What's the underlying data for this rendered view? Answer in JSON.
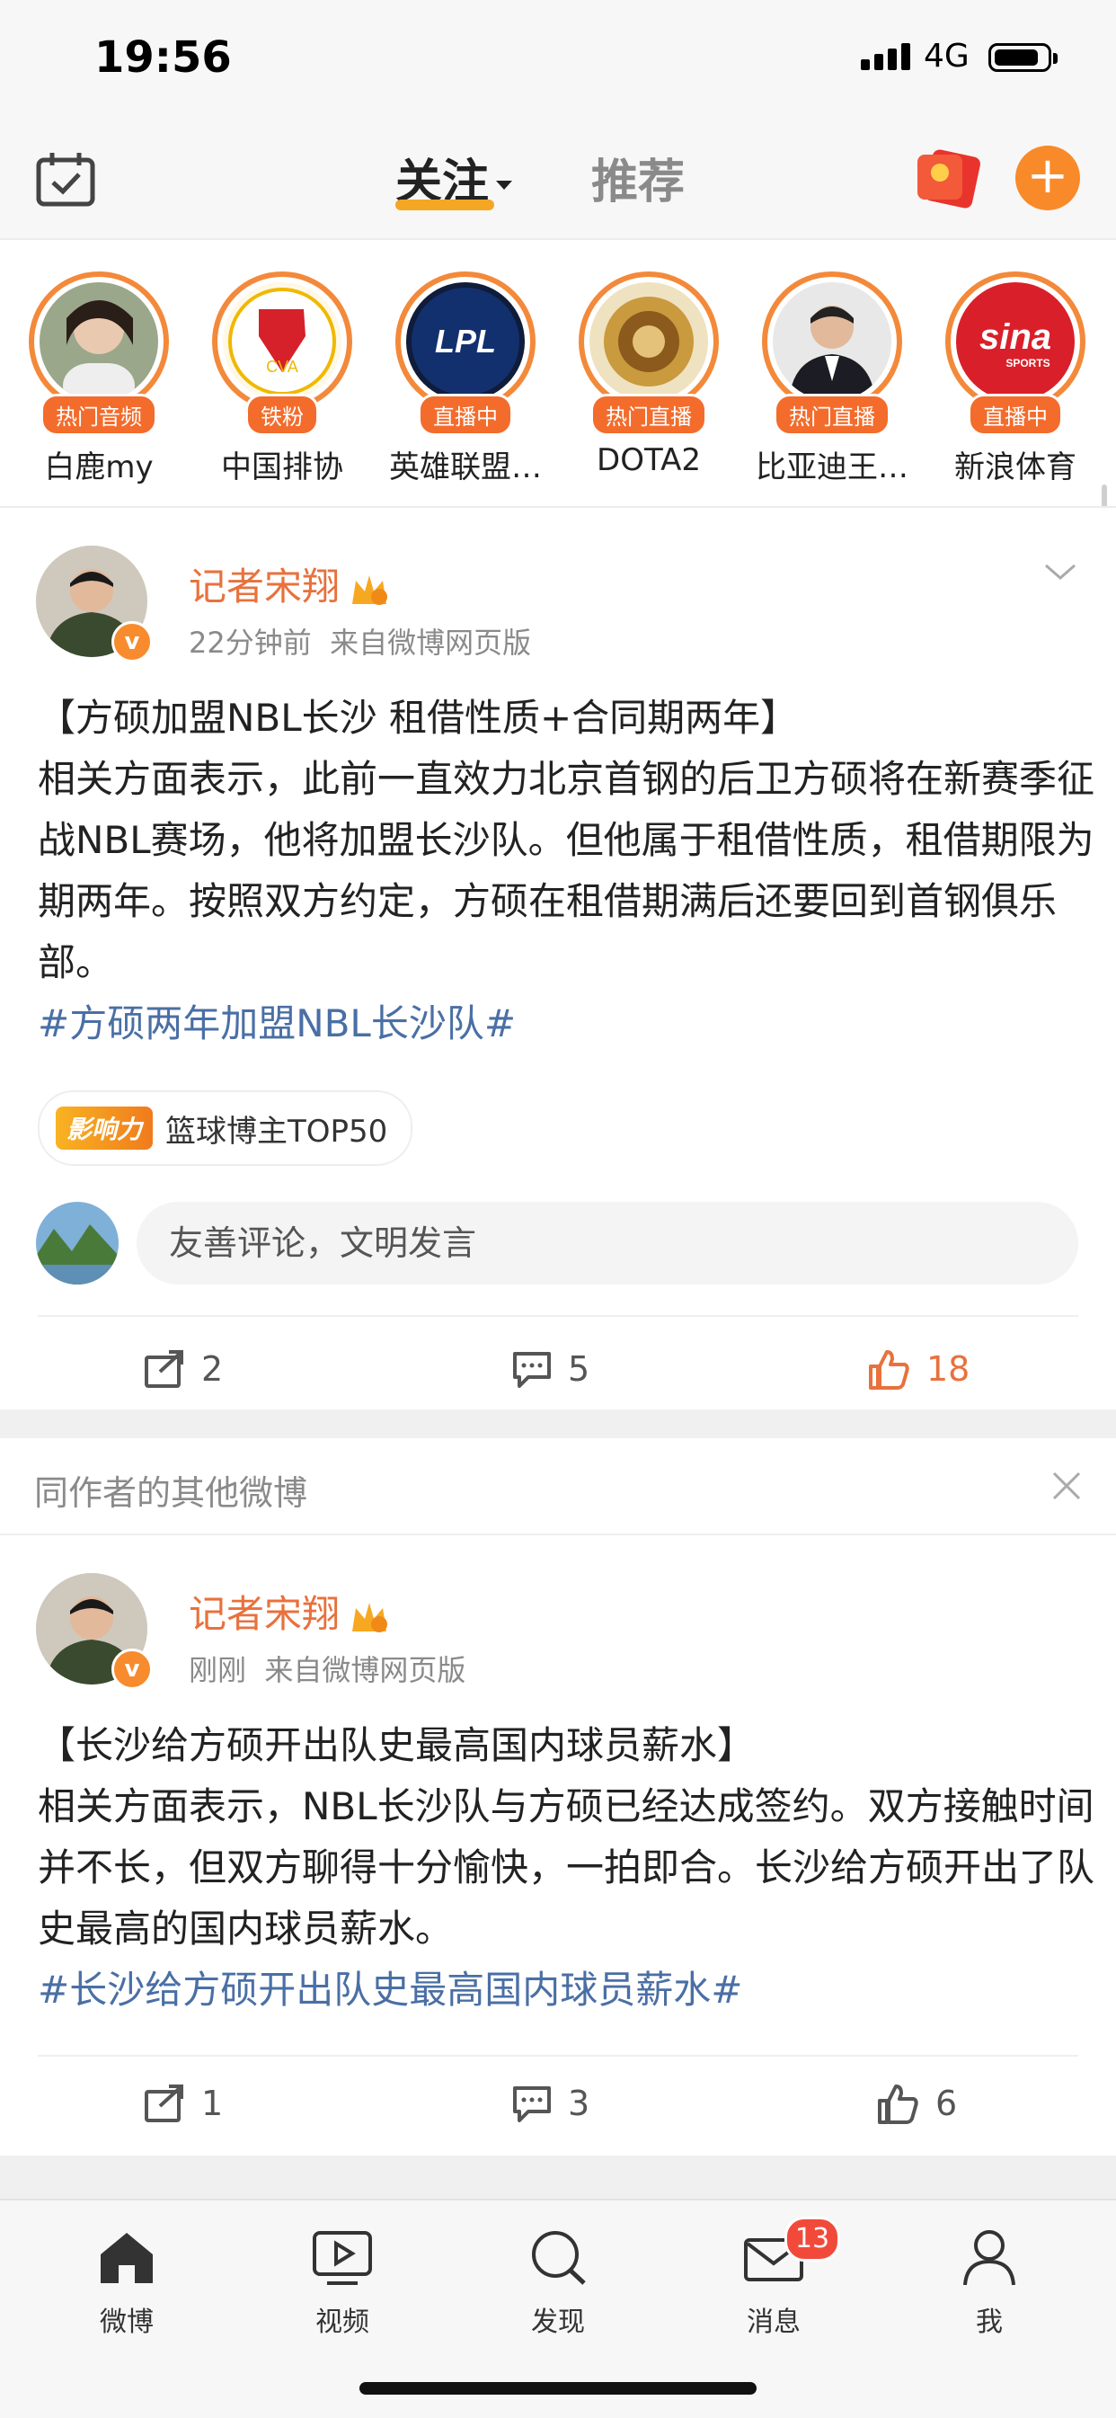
{
  "status_bar": {
    "time": "19:56",
    "network": "4G"
  },
  "top_nav": {
    "tab_follow": "关注",
    "tab_recommend": "推荐"
  },
  "stories": [
    {
      "name": "白鹿my",
      "badge": "热门音频"
    },
    {
      "name": "中国排协",
      "badge": "铁粉"
    },
    {
      "name": "英雄联盟…",
      "badge": "直播中"
    },
    {
      "name": "DOTA2",
      "badge": "热门直播"
    },
    {
      "name": "比亚迪王…",
      "badge": "热门直播"
    },
    {
      "name": "新浪体育",
      "badge": "直播中"
    }
  ],
  "story_logos": {
    "lpl": "LPL",
    "cva": "CVA",
    "sina": "sina",
    "sina_sub": "SPORTS"
  },
  "post1": {
    "author": "记者宋翔",
    "time": "22分钟前",
    "source": "来自微博网页版",
    "title_line": "【方硕加盟NBL长沙 租借性质+合同期两年】",
    "body": "相关方面表示，此前一直效力北京首钢的后卫方硕将在新赛季征战NBL赛场，他将加盟长沙队。但他属于租借性质，租借期限为期两年。按照双方约定，方硕在租借期满后还要回到首钢俱乐部。",
    "hashtag": "#方硕两年加盟NBL长沙队#",
    "influence_badge": "影响力",
    "influence_text": "篮球博主TOP50",
    "comment_placeholder": "友善评论，文明发言",
    "reposts": "2",
    "comments": "5",
    "likes": "18"
  },
  "section_header": "同作者的其他微博",
  "post2": {
    "author": "记者宋翔",
    "time": "刚刚",
    "source": "来自微博网页版",
    "title_line": "【长沙给方硕开出队史最高国内球员薪水】",
    "body": "相关方面表示，NBL长沙队与方硕已经达成签约。双方接触时间并不长，但双方聊得十分愉快，一拍即合。长沙给方硕开出了队史最高的国内球员薪水。",
    "hashtag": "#长沙给方硕开出队史最高国内球员薪水#",
    "reposts": "1",
    "comments": "3",
    "likes": "6"
  },
  "bottom_nav": [
    {
      "label": "微博"
    },
    {
      "label": "视频"
    },
    {
      "label": "发现"
    },
    {
      "label": "消息",
      "badge": "13"
    },
    {
      "label": "我"
    }
  ],
  "colors": {
    "accent": "#e8713c",
    "hashtag": "#4a6fa5",
    "badge_orange": "#f36c2c"
  }
}
